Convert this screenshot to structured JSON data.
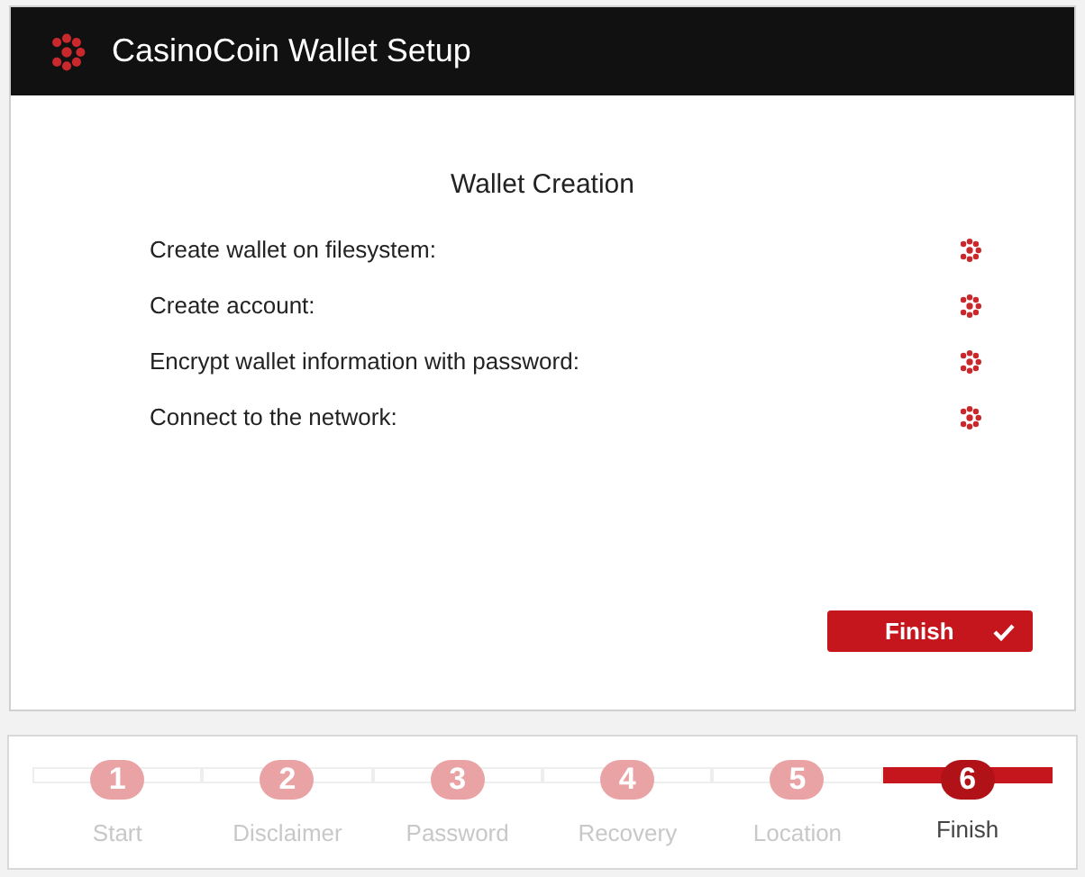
{
  "window": {
    "title": "CasinoCoin Wallet Setup"
  },
  "section_title": "Wallet Creation",
  "tasks": [
    {
      "label": "Create wallet on filesystem:"
    },
    {
      "label": "Create account:"
    },
    {
      "label": "Encrypt wallet information with password:"
    },
    {
      "label": "Connect to the network:"
    }
  ],
  "finish_button": {
    "label": "Finish"
  },
  "steps": [
    {
      "number": "1",
      "label": "Start",
      "selected": false
    },
    {
      "number": "2",
      "label": "Disclaimer",
      "selected": false
    },
    {
      "number": "3",
      "label": "Password",
      "selected": false
    },
    {
      "number": "4",
      "label": "Recovery",
      "selected": false
    },
    {
      "number": "5",
      "label": "Location",
      "selected": false
    },
    {
      "number": "6",
      "label": "Finish",
      "selected": true
    }
  ]
}
